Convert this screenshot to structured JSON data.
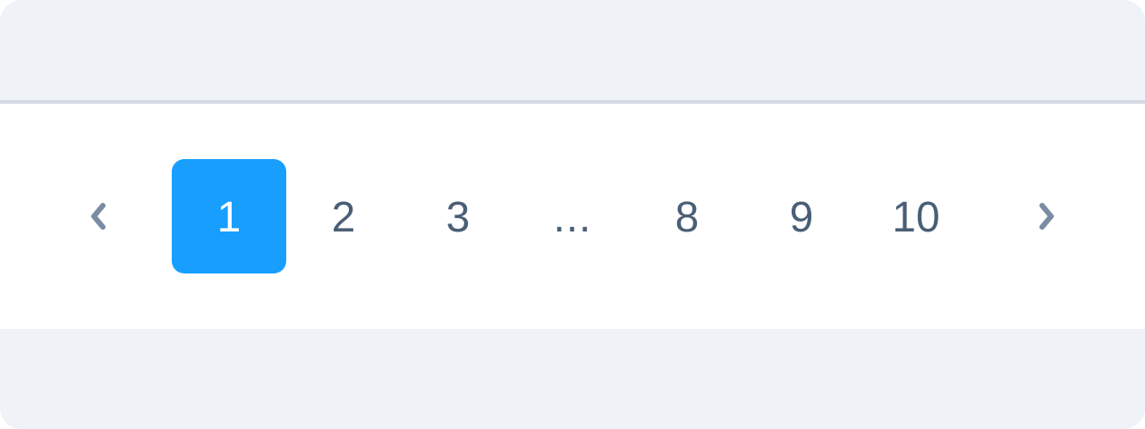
{
  "pagination": {
    "prev": {
      "icon": "chevron-left-icon"
    },
    "next": {
      "icon": "chevron-right-icon"
    },
    "pages": [
      "1",
      "2",
      "3",
      "8",
      "9",
      "10"
    ],
    "ellipsis": "...",
    "current_page": "1"
  },
  "colors": {
    "active_bg": "#189ffe",
    "active_text": "#ffffff",
    "page_text": "#4a5f76",
    "arrow": "#7a8ca3",
    "band_bg": "#eff3f8",
    "divider": "#d4dae3"
  }
}
